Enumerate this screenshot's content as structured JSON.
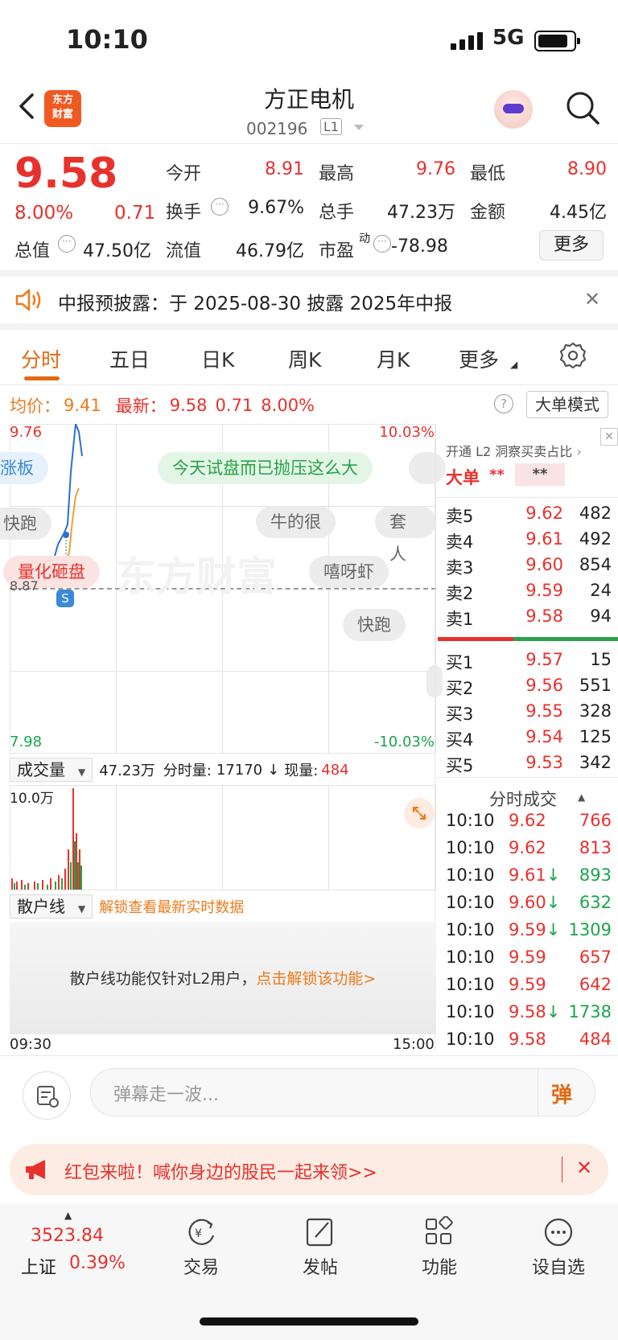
{
  "status_bar": {
    "time": "10:10",
    "network": "5G"
  },
  "header": {
    "logo_text_1": "东方",
    "logo_text_2": "财富",
    "stock_name": "方正电机",
    "stock_code": "002196",
    "level_badge": "L1"
  },
  "quote": {
    "price": "9.58",
    "change_pct": "8.00%",
    "change": "0.71",
    "open_label": "今开",
    "open": "8.91",
    "high_label": "最高",
    "high": "9.76",
    "low_label": "最低",
    "low": "8.90",
    "turnover_label": "换手",
    "turnover": "9.67%",
    "volume_label": "总手",
    "volume": "47.23万",
    "amount_label": "金额",
    "amount": "4.45亿",
    "mktcap_label": "总值",
    "mktcap": "47.50亿",
    "float_label": "流值",
    "float": "46.79亿",
    "pe_label": "市盈",
    "pe_sup": "动",
    "pe": "-78.98",
    "more_label": "更多"
  },
  "notice": {
    "text": "中报预披露：于 2025-08-30 披露 2025年中报"
  },
  "tabs": [
    "分时",
    "五日",
    "日K",
    "周K",
    "月K",
    "更多"
  ],
  "chart_header": {
    "avg_label": "均价：",
    "avg": "9.41",
    "latest_label": "最新：",
    "latest": "9.58",
    "chg": "0.71",
    "pct": "8.00%",
    "mode_btn": "大单模式"
  },
  "chart": {
    "top_price": "9.76",
    "top_pct": "10.03%",
    "bottom_price": "7.98",
    "bottom_pct": "-10.03%",
    "ref_price": "8.87",
    "watermark": "东方财富",
    "marker": "S",
    "danmu": [
      "涨板",
      "今天试盘而已抛压这么大",
      "快跑",
      "牛的很",
      "套人",
      "量化砸盘",
      "嘻呀虾",
      "快跑"
    ]
  },
  "orderbook": {
    "l2_link": "开通 L2 洞察买卖占比",
    "big_order_label": "大单",
    "big_order_v1": "**",
    "big_order_v2": "**",
    "asks": [
      {
        "name": "卖5",
        "price": "9.62",
        "vol": "482"
      },
      {
        "name": "卖4",
        "price": "9.61",
        "vol": "492"
      },
      {
        "name": "卖3",
        "price": "9.60",
        "vol": "854"
      },
      {
        "name": "卖2",
        "price": "9.59",
        "vol": "24"
      },
      {
        "name": "卖1",
        "price": "9.58",
        "vol": "94"
      }
    ],
    "bids": [
      {
        "name": "买1",
        "price": "9.57",
        "vol": "15"
      },
      {
        "name": "买2",
        "price": "9.56",
        "vol": "551"
      },
      {
        "name": "买3",
        "price": "9.55",
        "vol": "328"
      },
      {
        "name": "买4",
        "price": "9.54",
        "vol": "125"
      },
      {
        "name": "买5",
        "price": "9.53",
        "vol": "342"
      }
    ],
    "ticks_title": "分时成交",
    "ticks": [
      {
        "t": "10:10",
        "p": "9.62",
        "arrow": "",
        "v": "766",
        "color": "red"
      },
      {
        "t": "10:10",
        "p": "9.62",
        "arrow": "",
        "v": "813",
        "color": "red"
      },
      {
        "t": "10:10",
        "p": "9.61",
        "arrow": "↓",
        "v": "893",
        "color": "green"
      },
      {
        "t": "10:10",
        "p": "9.60",
        "arrow": "↓",
        "v": "632",
        "color": "green"
      },
      {
        "t": "10:10",
        "p": "9.59",
        "arrow": "↓",
        "v": "1309",
        "color": "green"
      },
      {
        "t": "10:10",
        "p": "9.59",
        "arrow": "",
        "v": "657",
        "color": "red"
      },
      {
        "t": "10:10",
        "p": "9.59",
        "arrow": "",
        "v": "642",
        "color": "red"
      },
      {
        "t": "10:10",
        "p": "9.58",
        "arrow": "↓",
        "v": "1738",
        "color": "green"
      },
      {
        "t": "10:10",
        "p": "9.58",
        "arrow": "",
        "v": "484",
        "color": "red"
      }
    ]
  },
  "volume": {
    "selector": "成交量",
    "total": "47.23万",
    "minute_label": "分时量:",
    "minute_vol": "17170",
    "current_label": "现量:",
    "current": "484",
    "scale": "10.0万"
  },
  "retail": {
    "selector": "散户线",
    "unlock_text": "解锁查看最新实时数据",
    "box_text": "散户线功能仅针对L2用户，",
    "box_link": "点击解锁该功能"
  },
  "time_axis": {
    "start": "09:30",
    "end": "15:00"
  },
  "danmu_bar": {
    "placeholder": "弹幕走一波...",
    "send": "弹"
  },
  "redpacket": {
    "text": "红包来啦！喊你身边的股民一起来领>>"
  },
  "bottom_nav": {
    "index_value": "3523.84",
    "index_name": "上证",
    "index_pct": "0.39%",
    "items": [
      "交易",
      "发帖",
      "功能",
      "设自选"
    ]
  }
}
